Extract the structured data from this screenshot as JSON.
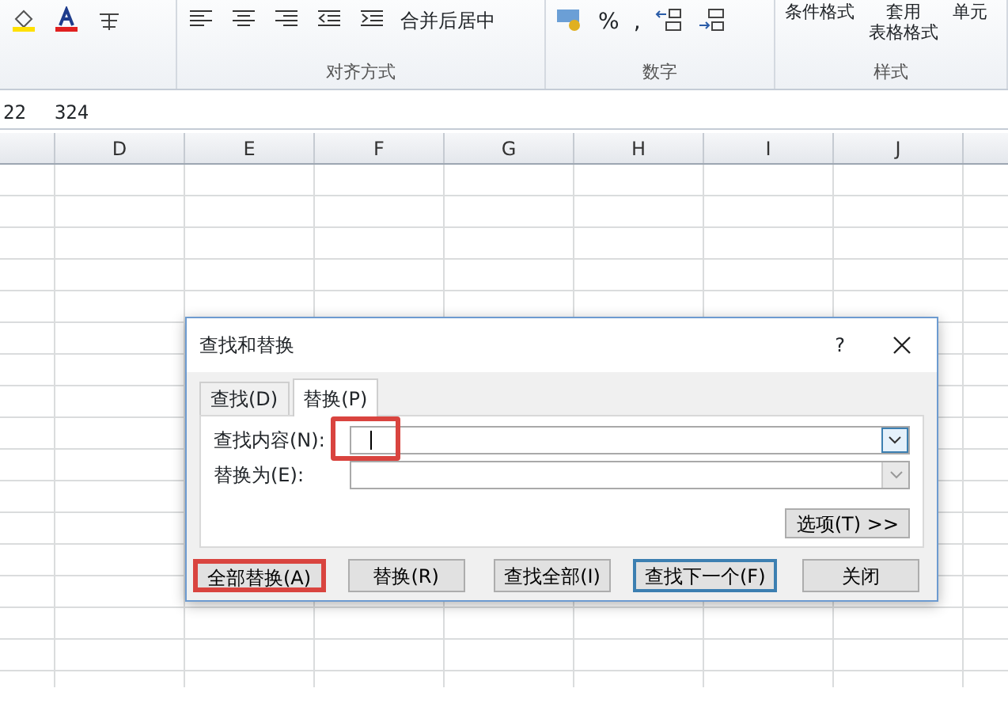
{
  "ribbon": {
    "groups": [
      {
        "items": [
          {
            "kind": "icon"
          },
          {
            "kind": "icon"
          },
          {
            "kind": "icon"
          }
        ]
      },
      {
        "label": "对齐方式",
        "items": [
          {
            "kind": "icon"
          },
          {
            "kind": "icon"
          },
          {
            "kind": "icon"
          },
          {
            "kind": "icon"
          },
          {
            "kind": "icon"
          },
          {
            "kind": "merge",
            "text": "合并后居中"
          }
        ]
      },
      {
        "label": "数字",
        "items": [
          {
            "kind": "icon"
          },
          {
            "kind": "text",
            "text": "%"
          },
          {
            "kind": "text",
            "text": ","
          },
          {
            "kind": "icon"
          },
          {
            "kind": "icon"
          }
        ]
      },
      {
        "label": "样式",
        "items": [
          {
            "kind": "stack",
            "text": "条件格式"
          },
          {
            "kind": "stack",
            "text": "套用",
            "text2": "表格格式"
          },
          {
            "kind": "stack",
            "text": "单元"
          }
        ]
      }
    ]
  },
  "formula_bar": {
    "name_box": "22",
    "content": "324"
  },
  "columns": [
    "D",
    "E",
    "F",
    "G",
    "H",
    "I",
    "J"
  ],
  "dialog": {
    "title": "查找和替换",
    "help": "?",
    "tabs": [
      {
        "label": "查找(D)",
        "selected": false
      },
      {
        "label": "替换(P)",
        "selected": true
      }
    ],
    "fields": [
      {
        "label": "查找内容(N):",
        "focused": true,
        "disabled": false,
        "highlighted": true
      },
      {
        "label": "替换为(E):",
        "focused": false,
        "disabled": true,
        "highlighted": false
      }
    ],
    "options_button": "选项(T) >>",
    "buttons": [
      {
        "label": "全部替换(A)",
        "default": false,
        "highlighted": true
      },
      {
        "label": "替换(R)",
        "default": false,
        "highlighted": false
      },
      {
        "label": "查找全部(I)",
        "default": false,
        "highlighted": false
      },
      {
        "label": "查找下一个(F)",
        "default": true,
        "highlighted": false
      },
      {
        "label": "关闭",
        "default": false,
        "highlighted": false
      }
    ]
  }
}
